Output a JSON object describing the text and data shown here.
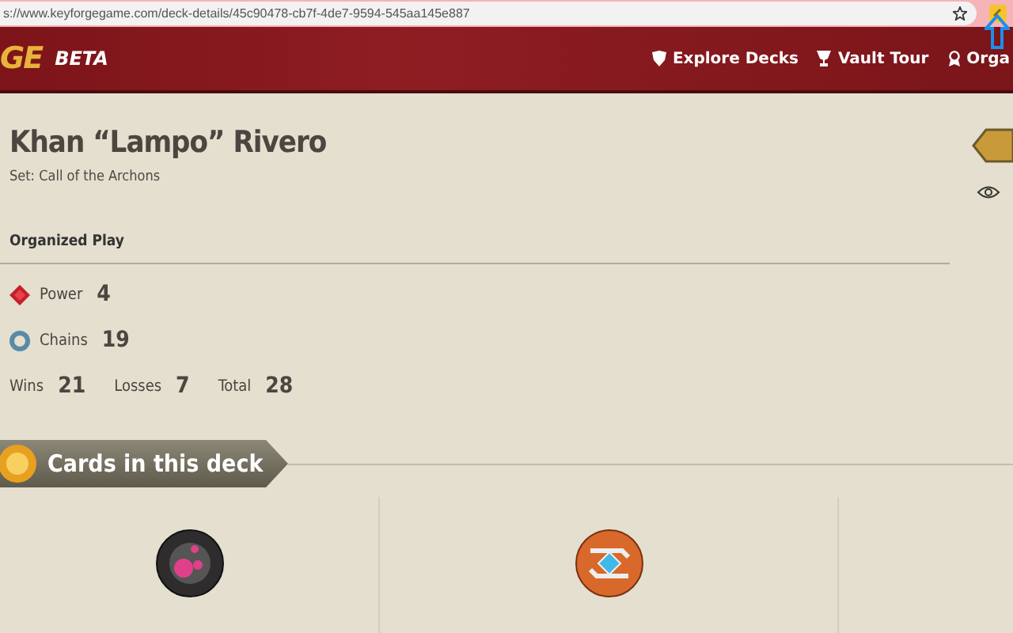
{
  "browser": {
    "url": "s://www.keyforgegame.com/deck-details/45c90478-cb7f-4de7-9594-545aa145e887"
  },
  "header": {
    "logo": "GE",
    "badge": "BETA",
    "nav": [
      {
        "label": "Explore Decks",
        "kind": "shield"
      },
      {
        "label": "Vault Tour",
        "kind": "cup"
      },
      {
        "label": "Orga",
        "kind": "medal"
      }
    ]
  },
  "deck": {
    "name": "Khan “Lampo” Rivero",
    "set": "Set: Call of the Archons"
  },
  "organized_play": {
    "title": "Organized Play",
    "stats": [
      {
        "kind": "power",
        "label": "Power",
        "value": "4"
      },
      {
        "kind": "chains",
        "label": "Chains",
        "value": "19"
      }
    ],
    "record": [
      {
        "label": "Wins",
        "value": "21"
      },
      {
        "label": "Losses",
        "value": "7"
      },
      {
        "label": "Total",
        "value": "28"
      }
    ]
  },
  "cards": {
    "title": "Cards in this deck",
    "houses": [
      {
        "kind": "dis"
      },
      {
        "kind": "logos"
      }
    ]
  }
}
